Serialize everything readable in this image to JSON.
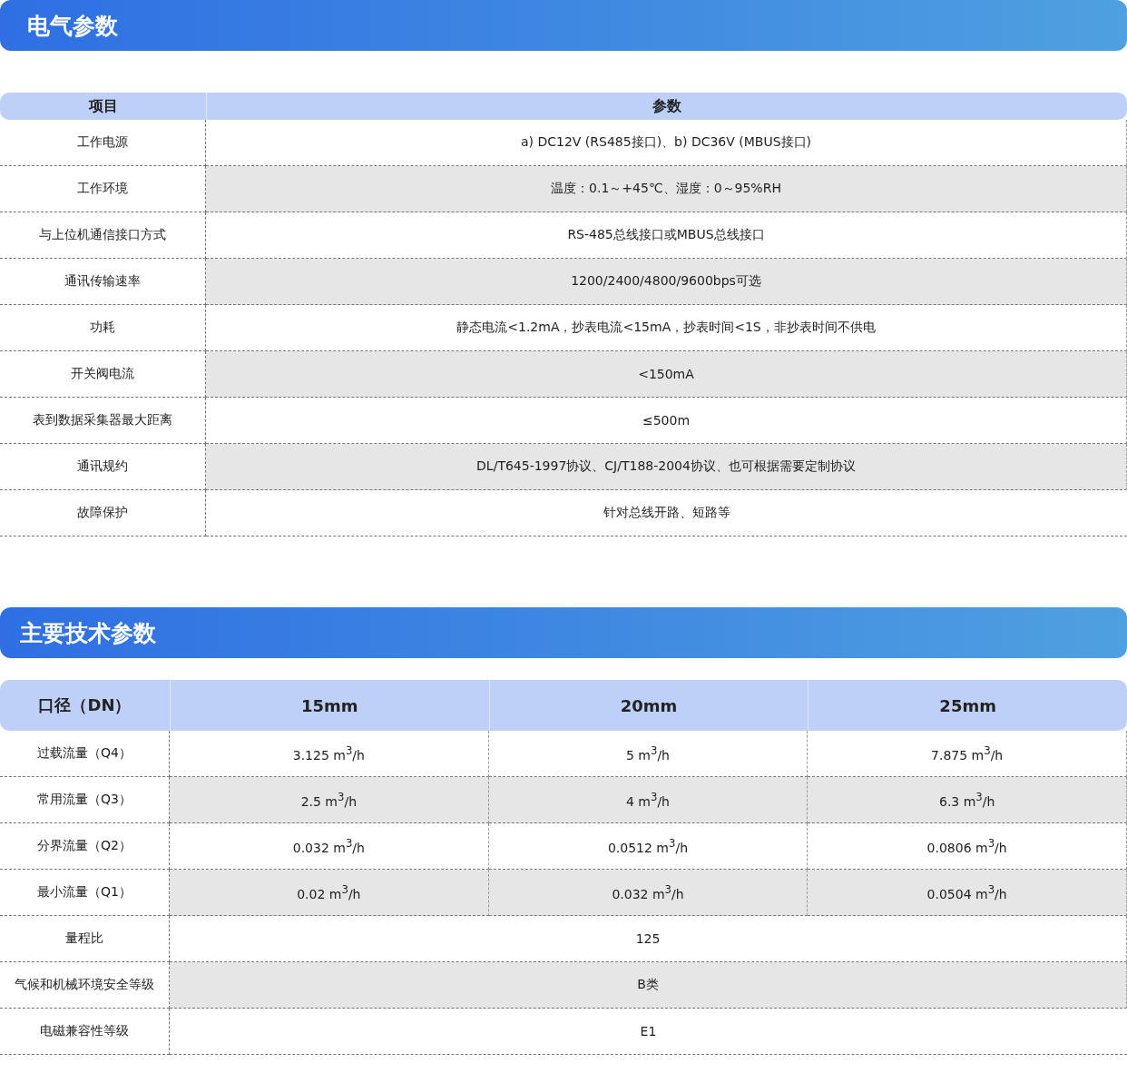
{
  "sections": [
    {
      "title": "电气参数",
      "table": {
        "columns": [
          "项目",
          "参数"
        ],
        "rows": [
          {
            "label": "工作电源",
            "values": [
              "a) DC12V (RS485接口)、b) DC36V (MBUS接口)"
            ]
          },
          {
            "label": "工作环境",
            "values": [
              "温度：0.1～+45℃、湿度：0～95%RH"
            ]
          },
          {
            "label": "与上位机通信接口方式",
            "values": [
              "RS-485总线接口或MBUS总线接口"
            ]
          },
          {
            "label": "通讯传输速率",
            "values": [
              "1200/2400/4800/9600bps可选"
            ]
          },
          {
            "label": "功耗",
            "values": [
              "静态电流<1.2mA，抄表电流<15mA，抄表时间<1S，非抄表时间不供电"
            ]
          },
          {
            "label": "开关阀电流",
            "values": [
              "<150mA"
            ]
          },
          {
            "label": "表到数据采集器最大距离",
            "values": [
              "≤500m"
            ]
          },
          {
            "label": "通讯规约",
            "values": [
              "DL/T645-1997协议、CJ/T188-2004协议、也可根据需要定制协议"
            ]
          },
          {
            "label": "故障保护",
            "values": [
              "针对总线开路、短路等"
            ]
          }
        ]
      }
    },
    {
      "title": "主要技术参数",
      "table": {
        "columns": [
          "口径（DN）",
          "15mm",
          "20mm",
          "25mm"
        ],
        "rows": [
          {
            "label": "过载流量（Q4）",
            "values": [
              "3.125 m$^{3}$/h",
              "5 m$^{3}$/h",
              "7.875 m$^{3}$/h"
            ]
          },
          {
            "label": "常用流量（Q3）",
            "values": [
              "2.5 m$^{3}$/h",
              "4 m$^{3}$/h",
              "6.3 m$^{3}$/h"
            ]
          },
          {
            "label": "分界流量（Q2）",
            "values": [
              "0.032 m$^{3}$/h",
              "0.0512 m$^{3}$/h",
              "0.0806 m$^{3}$/h"
            ]
          },
          {
            "label": "最小流量（Q1）",
            "values": [
              "0.02 m$^{3}$/h",
              "0.032 m$^{3}$/h",
              "0.0504 m$^{3}$/h"
            ]
          },
          {
            "label": "量程比",
            "values": [
              "125"
            ]
          },
          {
            "label": "气候和机械环境安全等级",
            "values": [
              "B类"
            ]
          },
          {
            "label": "电磁兼容性等级",
            "values": [
              "E1"
            ]
          }
        ]
      }
    }
  ]
}
